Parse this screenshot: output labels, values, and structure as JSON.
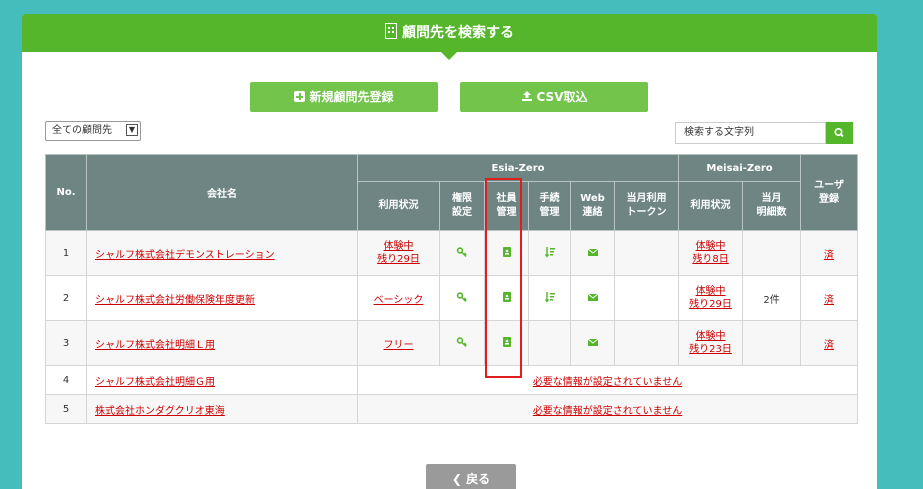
{
  "header": {
    "title": "顧問先を検索する"
  },
  "toolbar": {
    "new_label": "新規顧問先登録",
    "csv_label": "CSV取込"
  },
  "filter": {
    "selected": "全ての顧問先"
  },
  "search": {
    "placeholder": "検索する文字列"
  },
  "table": {
    "group_headers": {
      "no": "No.",
      "company": "会社名",
      "esia": "Esia-Zero",
      "meisai": "Meisai-Zero",
      "user": "ユーザ\n登録"
    },
    "esia_columns": [
      "利用状況",
      "権限\n設定",
      "社員\n管理",
      "手続\n管理",
      "Web\n連絡",
      "当月利用\nトークン"
    ],
    "meisai_columns": [
      "利用状況",
      "当月\n明細数"
    ],
    "rows": [
      {
        "no": "1",
        "company": "シャルフ株式会社デモンストレーション",
        "esia_status": "体験中\n残り29日",
        "meisai_status": "体験中\n残り8日",
        "meisai_count": "",
        "user": "済"
      },
      {
        "no": "2",
        "company": "シャルフ株式会社労働保険年度更新",
        "esia_status": "ベーシック",
        "meisai_status": "体験中\n残り29日",
        "meisai_count": "2件",
        "user": "済"
      },
      {
        "no": "3",
        "company": "シャルフ株式会社明細Ｌ用",
        "esia_status": "フリー",
        "meisai_status": "体験中\n残り23日",
        "meisai_count": "",
        "user": "済"
      },
      {
        "no": "4",
        "company": "シャルフ株式会社明細Ｇ用",
        "notice": "必要な情報が設定されていません"
      },
      {
        "no": "5",
        "company": "株式会社ホンダグクリオ東海",
        "notice": "必要な情報が設定されていません"
      }
    ]
  },
  "footer": {
    "back_label": "戻る"
  },
  "colors": {
    "background": "#45bdbd",
    "brand_green": "#56b62b",
    "button_green": "#72c44b",
    "table_header": "#6e8584",
    "link_red": "#cc0000",
    "highlight_box": "#e01e1e"
  }
}
